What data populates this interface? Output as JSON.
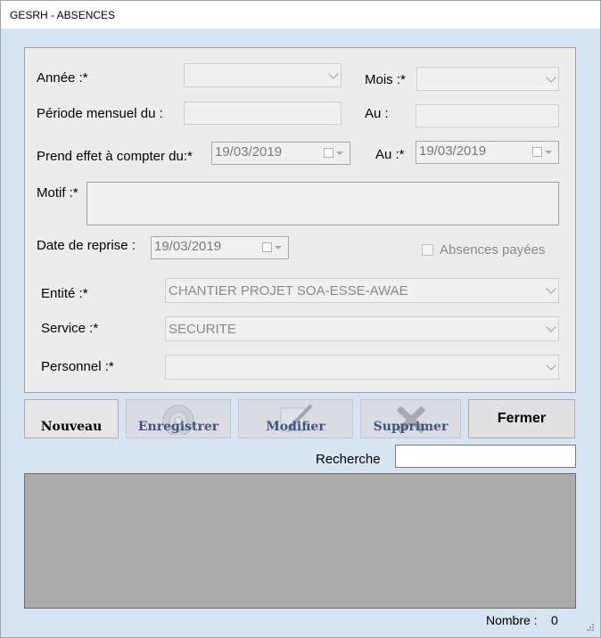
{
  "window": {
    "title": "GESRH - ABSENCES"
  },
  "form": {
    "annee_label": "Année :*",
    "annee_value": "",
    "mois_label": "Mois :*",
    "mois_value": "",
    "periode_label": "Période mensuel du :",
    "periode_value": "",
    "au1_label": "Au :",
    "au1_value": "",
    "prend_effet_label": "Prend effet à compter du:*",
    "prend_effet_value": "19/03/2019",
    "au2_label": "Au :*",
    "au2_value": "19/03/2019",
    "motif_label": "Motif :*",
    "motif_value": "",
    "date_reprise_label": "Date de reprise :",
    "date_reprise_value": "19/03/2019",
    "absences_payees_label": "Absences payées",
    "absences_payees_checked": false,
    "entite_label": "Entité :*",
    "entite_value": "CHANTIER PROJET SOA-ESSE-AWAE",
    "service_label": "Service :*",
    "service_value": "SECURITE",
    "personnel_label": "Personnel :*",
    "personnel_value": ""
  },
  "toolbar": {
    "nouveau": "Nouveau",
    "enregistrer": "Enregistrer",
    "modifier": "Modifier",
    "supprimer": "Supprimer",
    "fermer": "Fermer"
  },
  "search": {
    "label": "Recherche",
    "value": ""
  },
  "footer": {
    "nombre_label": "Nombre :",
    "nombre_value": "0"
  },
  "icons": {
    "enregistrer": "disc-icon",
    "modifier": "pencil-icon",
    "supprimer": "delete-x-icon",
    "dropdown": "chevron-down-icon",
    "calendar": "calendar-icon"
  }
}
